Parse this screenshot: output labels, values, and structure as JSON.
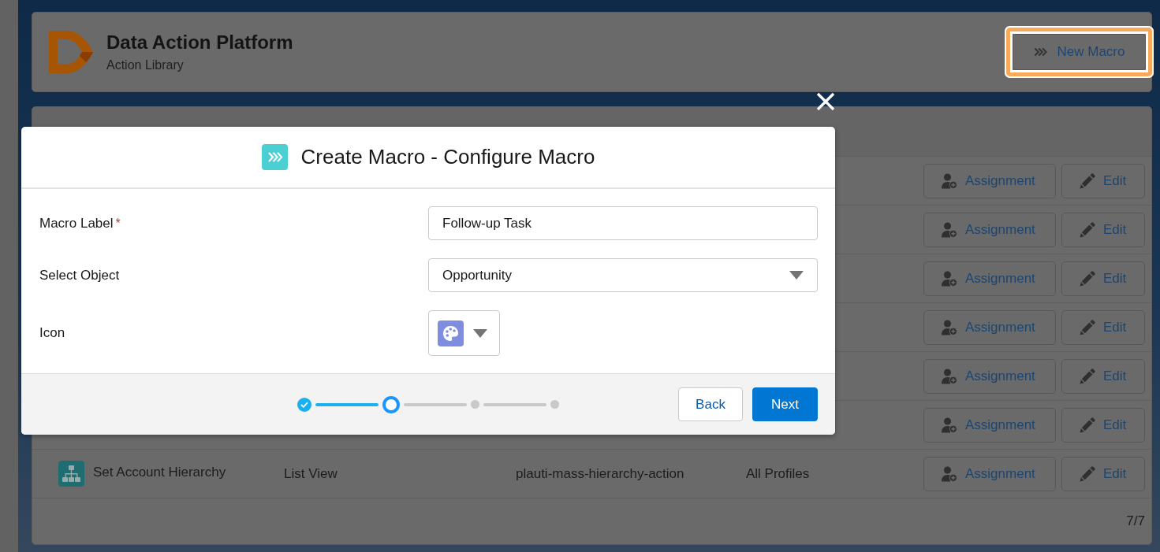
{
  "header": {
    "title": "Data Action Platform",
    "subtitle": "Action Library",
    "new_button": {
      "label": "New Macro",
      "highlighted": true
    }
  },
  "table": {
    "rows": [
      {
        "buttons": [
          {
            "kind": "assign",
            "label": "Assignment"
          },
          {
            "kind": "edit",
            "label": "Edit"
          }
        ]
      },
      {
        "buttons": [
          {
            "kind": "assign",
            "label": "Assignment"
          },
          {
            "kind": "edit",
            "label": "Edit"
          }
        ]
      },
      {
        "buttons": [
          {
            "kind": "assign",
            "label": "Assignment"
          },
          {
            "kind": "edit",
            "label": "Edit"
          }
        ]
      },
      {
        "buttons": [
          {
            "kind": "assign",
            "label": "Assignment"
          },
          {
            "kind": "edit",
            "label": "Edit"
          }
        ]
      },
      {
        "buttons": [
          {
            "kind": "assign",
            "label": "Assignment"
          },
          {
            "kind": "edit",
            "label": "Edit"
          }
        ]
      },
      {
        "buttons": [
          {
            "kind": "assign",
            "label": "Assignment"
          },
          {
            "kind": "edit",
            "label": "Edit"
          }
        ]
      },
      {
        "cells": [
          "Set Account Hierarchy",
          "List View",
          "plauti-mass-hierarchy-action",
          "All Profiles"
        ],
        "buttons": [
          {
            "kind": "assign",
            "label": "Assignment"
          },
          {
            "kind": "edit",
            "label": "Edit"
          }
        ]
      }
    ],
    "footer": "7/7"
  },
  "modal": {
    "title": "Create Macro - Configure Macro",
    "fields": [
      {
        "kind": "text",
        "label": "Macro Label",
        "required_mark": "*",
        "value": "Follow-up Task"
      },
      {
        "kind": "select",
        "label": "Select Object",
        "value": "Opportunity"
      },
      {
        "kind": "icon",
        "label": "Icon"
      }
    ],
    "steps": [
      {
        "completed": true,
        "selected": false
      },
      {
        "completed": false,
        "selected": true
      },
      {
        "completed": false,
        "selected": false
      },
      {
        "completed": false,
        "selected": false
      }
    ],
    "buttons": [
      {
        "kind": "neutral",
        "label": "Back"
      },
      {
        "kind": "brand",
        "label": "Next"
      }
    ]
  }
}
